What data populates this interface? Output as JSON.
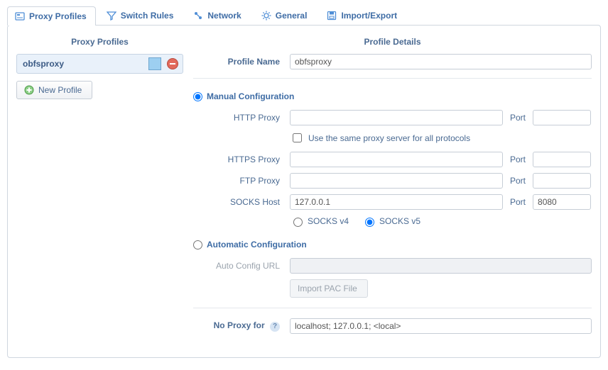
{
  "tabs": {
    "proxy_profiles": "Proxy Profiles",
    "switch_rules": "Switch Rules",
    "network": "Network",
    "general": "General",
    "import_export": "Import/Export"
  },
  "left": {
    "heading": "Proxy Profiles",
    "profile_name": "obfsproxy",
    "swatch_color": "#9dcff1",
    "new_profile_btn": "New Profile"
  },
  "details": {
    "heading": "Profile Details",
    "profile_name_label": "Profile Name",
    "profile_name_value": "obfsproxy",
    "manual_label": "Manual Configuration",
    "manual_selected": true,
    "http_label": "HTTP Proxy",
    "http_host": "",
    "http_port": "",
    "same_for_all_label": "Use the same proxy server for all protocols",
    "same_for_all_checked": false,
    "https_label": "HTTPS Proxy",
    "https_host": "",
    "https_port": "",
    "ftp_label": "FTP Proxy",
    "ftp_host": "",
    "ftp_port": "",
    "socks_label": "SOCKS Host",
    "socks_host": "127.0.0.1",
    "socks_port": "8080",
    "socks_v4_label": "SOCKS v4",
    "socks_v5_label": "SOCKS v5",
    "socks_v5_selected": true,
    "port_label": "Port",
    "auto_label": "Automatic Configuration",
    "auto_selected": false,
    "auto_url_label": "Auto Config URL",
    "auto_url_value": "",
    "import_pac_btn": "Import PAC File",
    "no_proxy_label": "No Proxy for",
    "no_proxy_value": "localhost; 127.0.0.1; <local>"
  }
}
